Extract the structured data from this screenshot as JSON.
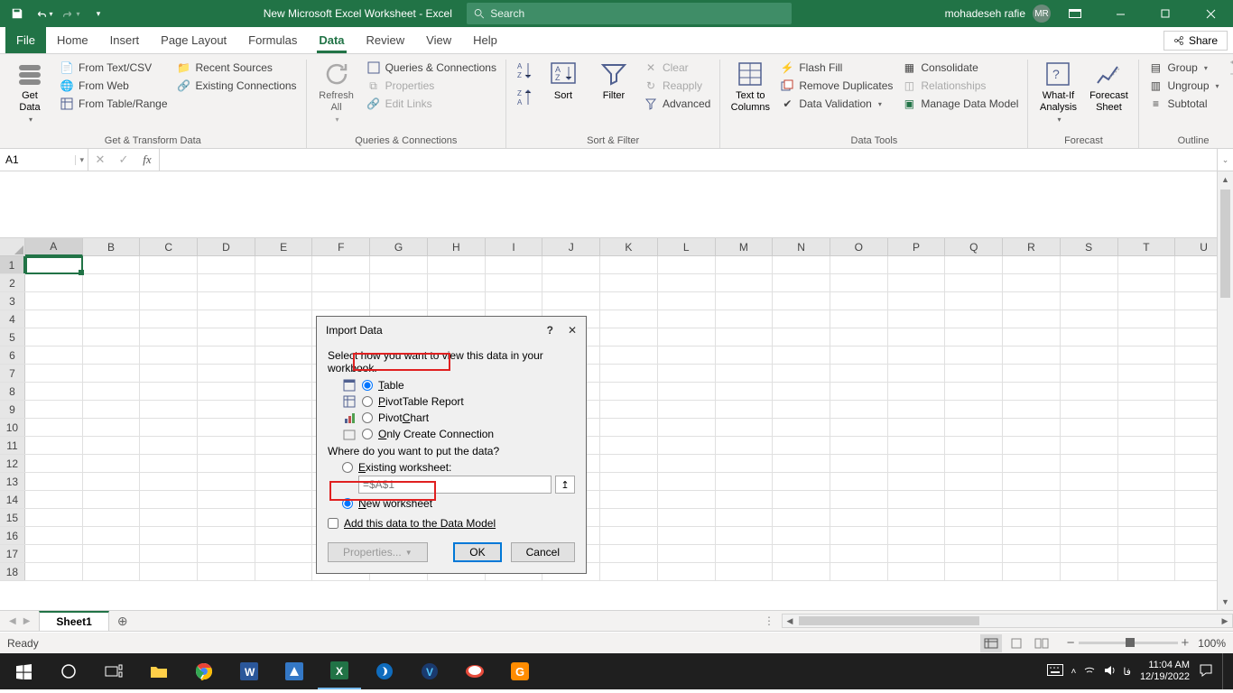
{
  "titlebar": {
    "doc_title": "New Microsoft Excel Worksheet  -  Excel",
    "search_placeholder": "Search",
    "user_name": "mohadeseh rafie",
    "user_initials": "MR"
  },
  "tabs": {
    "file": "File",
    "home": "Home",
    "insert": "Insert",
    "page_layout": "Page Layout",
    "formulas": "Formulas",
    "data": "Data",
    "review": "Review",
    "view": "View",
    "help": "Help",
    "share": "Share"
  },
  "ribbon": {
    "get_data": "Get\nData",
    "from_text": "From Text/CSV",
    "from_web": "From Web",
    "from_table": "From Table/Range",
    "recent": "Recent Sources",
    "existing": "Existing Connections",
    "get_transform": "Get & Transform Data",
    "refresh": "Refresh\nAll",
    "queries_conn": "Queries & Connections",
    "properties": "Properties",
    "edit_links": "Edit Links",
    "qc_group": "Queries & Connections",
    "sort": "Sort",
    "filter": "Filter",
    "clear": "Clear",
    "reapply": "Reapply",
    "advanced": "Advanced",
    "sort_filter": "Sort & Filter",
    "text_cols": "Text to\nColumns",
    "flash_fill": "Flash Fill",
    "remove_dup": "Remove Duplicates",
    "data_val": "Data Validation",
    "consolidate": "Consolidate",
    "relationships": "Relationships",
    "manage_dm": "Manage Data Model",
    "data_tools": "Data Tools",
    "whatif": "What-If\nAnalysis",
    "forecast_sheet": "Forecast\nSheet",
    "forecast": "Forecast",
    "group": "Group",
    "ungroup": "Ungroup",
    "subtotal": "Subtotal",
    "outline": "Outline"
  },
  "namebox": "A1",
  "columns": [
    "A",
    "B",
    "C",
    "D",
    "E",
    "F",
    "G",
    "H",
    "I",
    "J",
    "K",
    "L",
    "M",
    "N",
    "O",
    "P",
    "Q",
    "R",
    "S",
    "T",
    "U"
  ],
  "rows": [
    1,
    2,
    3,
    4,
    5,
    6,
    7,
    8,
    9,
    10,
    11,
    12,
    13,
    14,
    15,
    16,
    17,
    18
  ],
  "sheet_tab": "Sheet1",
  "status": "Ready",
  "zoom": "100%",
  "dialog": {
    "title": "Import Data",
    "prompt1": "Select how you want to view this data in your workbook.",
    "opt_table": "Table",
    "opt_pivot": "PivotTable Report",
    "opt_chart": "PivotChart",
    "opt_conn": "Only Create Connection",
    "prompt2": "Where do you want to put the data?",
    "opt_existing": "Existing worksheet:",
    "ref_value": "=$A$1",
    "opt_new": "New worksheet",
    "add_model": "Add this data to the Data Model",
    "properties": "Properties...",
    "ok": "OK",
    "cancel": "Cancel"
  },
  "taskbar": {
    "time": "11:04 AM",
    "date": "12/19/2022",
    "lang": "فا"
  }
}
